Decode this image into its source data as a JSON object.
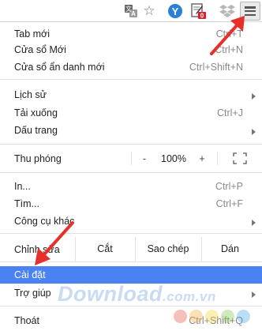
{
  "toolbar": {
    "icons": [
      "translate-icon",
      "star-icon",
      "extension-y-icon",
      "extension-note-icon",
      "dropbox-icon",
      "hamburger-menu-icon"
    ],
    "note_badge": "0",
    "y_letter": "Y"
  },
  "menu": {
    "new_tab": {
      "label": "Tab mới",
      "shortcut": "Ctrl+T"
    },
    "new_window": {
      "label": "Cửa sổ Mới",
      "shortcut": "Ctrl+N"
    },
    "incognito": {
      "label": "Cửa sổ ẩn danh mới",
      "shortcut": "Ctrl+Shift+N"
    },
    "history": {
      "label": "Lịch sử"
    },
    "downloads": {
      "label": "Tải xuống",
      "shortcut": "Ctrl+J"
    },
    "bookmarks": {
      "label": "Dấu trang"
    },
    "zoom": {
      "label": "Thu phóng",
      "minus": "-",
      "value": "100%",
      "plus": "+"
    },
    "print": {
      "label": "In...",
      "shortcut": "Ctrl+P"
    },
    "find": {
      "label": "Tìm...",
      "shortcut": "Ctrl+F"
    },
    "more_tools": {
      "label": "Công cụ khác"
    },
    "edit": {
      "label": "Chỉnh sửa",
      "cut": "Cắt",
      "copy": "Sao chép",
      "paste": "Dán"
    },
    "settings": {
      "label": "Cài đặt"
    },
    "help": {
      "label": "Trợ giúp"
    },
    "exit": {
      "label": "Thoát",
      "shortcut": "Ctrl+Shift+Q"
    }
  },
  "watermark": {
    "main": "Download",
    "suffix": ".com.vn"
  },
  "colors": {
    "highlight": "#4b82f3",
    "annotation_arrow": "#e8302a",
    "y_extension": "#2a7fd6",
    "badge": "#d9232d"
  }
}
